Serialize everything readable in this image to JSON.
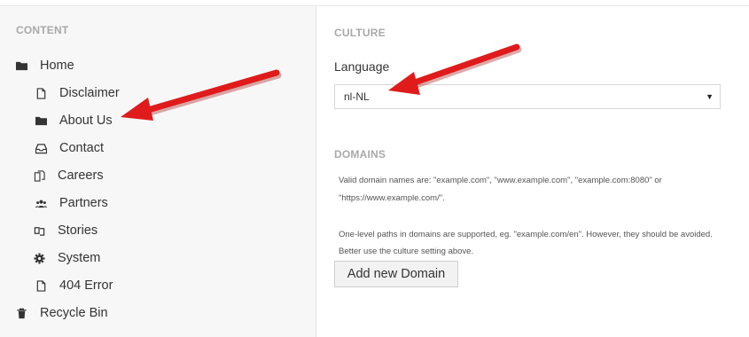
{
  "sidebar": {
    "section_title": "CONTENT",
    "items": [
      {
        "label": "Home",
        "icon": "folder-icon"
      },
      {
        "label": "Disclaimer",
        "icon": "document-icon"
      },
      {
        "label": "About Us",
        "icon": "folder-icon"
      },
      {
        "label": "Contact",
        "icon": "inbox-icon"
      },
      {
        "label": "Careers",
        "icon": "documents-icon"
      },
      {
        "label": "Partners",
        "icon": "users-icon"
      },
      {
        "label": "Stories",
        "icon": "stories-icon"
      },
      {
        "label": "System",
        "icon": "gear-icon"
      },
      {
        "label": "404 Error",
        "icon": "document-icon"
      },
      {
        "label": "Recycle Bin",
        "icon": "trash-icon"
      }
    ]
  },
  "culture": {
    "section_title": "CULTURE",
    "language_label": "Language",
    "language_value": "nl-NL"
  },
  "domains": {
    "section_title": "DOMAINS",
    "desc_line1": "Valid domain names are: \"example.com\", \"www.example.com\", \"example.com:8080\" or",
    "desc_line2": "\"https://www.example.com/\".",
    "desc_line3": "One-level paths in domains are supported, eg. \"example.com/en\". However, they should be avoided.",
    "desc_line4": "Better use the culture setting above.",
    "add_button_label": "Add new Domain"
  },
  "colors": {
    "annotation_arrow": "#e01b1b",
    "sidebar_bg": "#f7f7f7",
    "section_label": "#a9a9a9"
  }
}
